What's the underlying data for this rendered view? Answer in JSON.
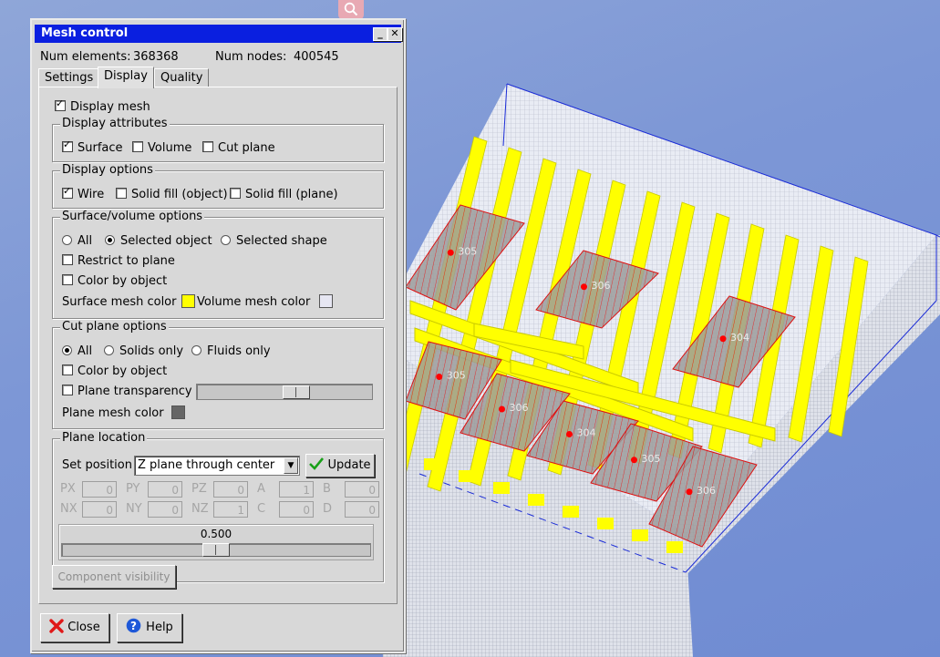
{
  "window": {
    "title": "Mesh control",
    "minimize_glyph": "_",
    "close_glyph": "✕"
  },
  "stats": {
    "elements_label": "Num elements:",
    "elements_value": "368368",
    "nodes_label": "Num nodes:",
    "nodes_value": "400545"
  },
  "tabs": [
    "Settings",
    "Display",
    "Quality"
  ],
  "active_tab": "Display",
  "display_mesh": {
    "label": "Display mesh",
    "checked": true
  },
  "display_attributes": {
    "title": "Display attributes",
    "items": [
      {
        "label": "Surface",
        "checked": true
      },
      {
        "label": "Volume",
        "checked": false
      },
      {
        "label": "Cut plane",
        "checked": false
      }
    ]
  },
  "display_options": {
    "title": "Display options",
    "items": [
      {
        "label": "Wire",
        "checked": true
      },
      {
        "label": "Solid fill (object)",
        "checked": false
      },
      {
        "label": "Solid fill (plane)",
        "checked": false
      }
    ]
  },
  "surface_volume": {
    "title": "Surface/volume options",
    "radios": [
      {
        "label": "All",
        "checked": false
      },
      {
        "label": "Selected object",
        "checked": true
      },
      {
        "label": "Selected shape",
        "checked": false
      }
    ],
    "restrict_to_plane": {
      "label": "Restrict to plane",
      "checked": false
    },
    "color_by_object": {
      "label": "Color by object",
      "checked": false
    },
    "surface_mesh_color_label": "Surface mesh color",
    "surface_mesh_color": "#ffff00",
    "volume_mesh_color_label": "Volume mesh color",
    "volume_mesh_color": "#e6e6f2"
  },
  "cut_plane": {
    "title": "Cut plane options",
    "radios": [
      {
        "label": "All",
        "checked": true
      },
      {
        "label": "Solids only",
        "checked": false
      },
      {
        "label": "Fluids only",
        "checked": false
      }
    ],
    "color_by_object": {
      "label": "Color by object",
      "checked": false
    },
    "plane_transparency": {
      "label": "Plane transparency",
      "checked": false,
      "level": 0.58
    },
    "plane_mesh_color_label": "Plane mesh color",
    "plane_mesh_color": "#666666"
  },
  "plane_location": {
    "title": "Plane location",
    "set_position_label": "Set position",
    "select_value": "Z plane through center",
    "update_label": "Update",
    "fields": [
      {
        "label": "PX",
        "value": "0"
      },
      {
        "label": "PY",
        "value": "0"
      },
      {
        "label": "PZ",
        "value": "0"
      },
      {
        "label": "A",
        "value": "1"
      },
      {
        "label": "B",
        "value": "0"
      },
      {
        "label": "NX",
        "value": "0"
      },
      {
        "label": "NY",
        "value": "0"
      },
      {
        "label": "NZ",
        "value": "1"
      },
      {
        "label": "C",
        "value": "0"
      },
      {
        "label": "D",
        "value": "0"
      }
    ],
    "slider_value_text": "0.500",
    "slider_level": 0.5
  },
  "component_visibility_label": "Component visibility",
  "footer": {
    "close_label": "Close",
    "help_label": "Help"
  },
  "colors": {
    "title_bar": "#0a1fe0",
    "mesh_yellow": "#ffff00",
    "cut_plane_red": "#dd1111",
    "bounding_blue": "#1a2bd6"
  },
  "viewport_labels": [
    "305",
    "306",
    "304",
    "305",
    "306",
    "304",
    "305",
    "306"
  ]
}
